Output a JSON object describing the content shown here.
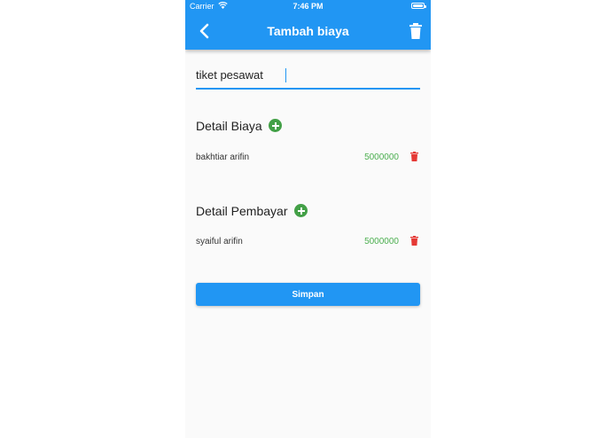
{
  "status_bar": {
    "carrier": "Carrier",
    "time": "7:46 PM"
  },
  "app_bar": {
    "title": "Tambah biaya",
    "back_icon": "chevron-left-icon",
    "delete_icon": "trash-icon"
  },
  "name_field": {
    "value": "tiket pesawat"
  },
  "detail_biaya": {
    "title": "Detail Biaya",
    "items": [
      {
        "name": "bakhtiar arifin",
        "amount": "5000000"
      }
    ]
  },
  "detail_pembayar": {
    "title": "Detail Pembayar",
    "items": [
      {
        "name": "syaiful arifin",
        "amount": "5000000"
      }
    ]
  },
  "save_button": {
    "label": "Simpan"
  },
  "colors": {
    "primary": "#2196f3",
    "add": "#43a047",
    "amount": "#4caf50",
    "delete": "#e53935"
  }
}
